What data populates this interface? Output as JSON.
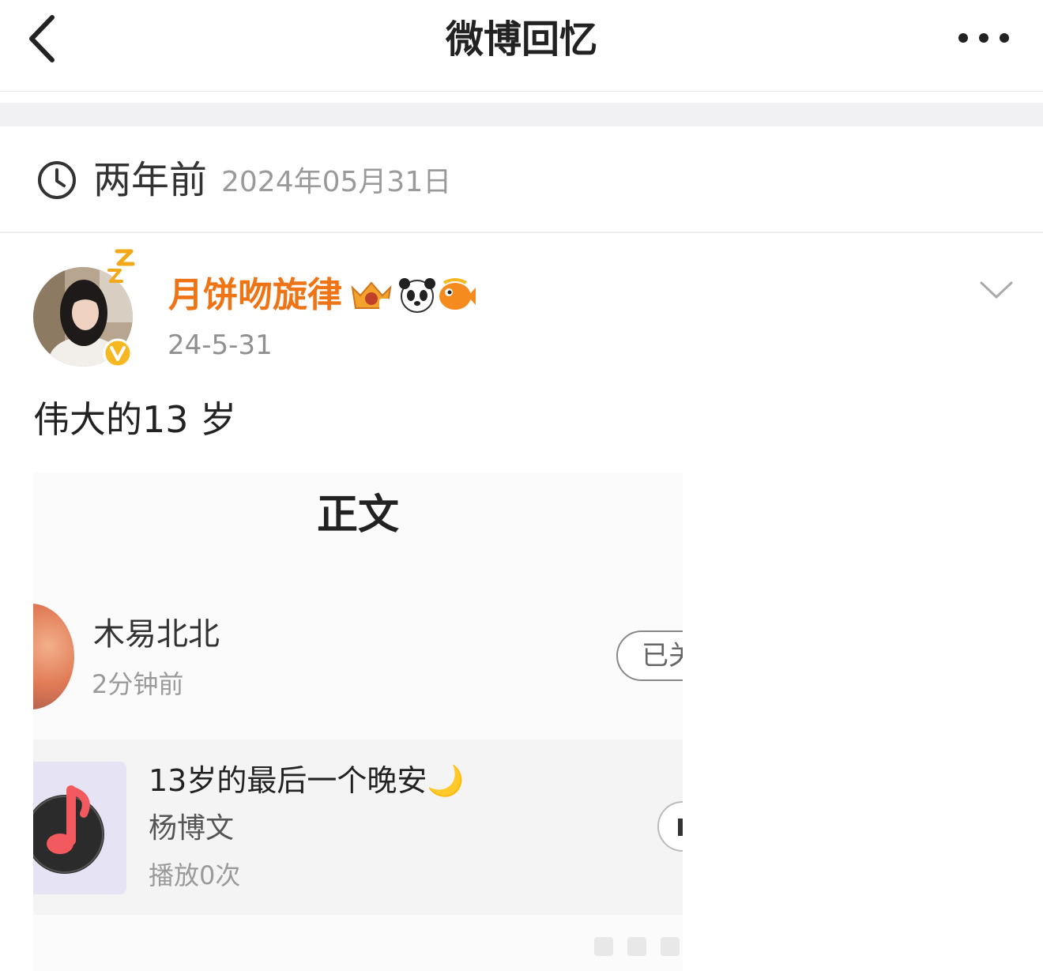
{
  "nav": {
    "title": "微博回忆"
  },
  "memory": {
    "ago": "两年前",
    "date": "2024年05月31日"
  },
  "post": {
    "author": "月饼吻旋律",
    "date": "24-5-31",
    "text": "伟大的13 岁"
  },
  "embedded": {
    "title": "正文",
    "user": "木易北北",
    "time": "2分钟前",
    "follow_label": "已关",
    "song": "13岁的最后一个晚安🌙",
    "artist": "杨博文",
    "plays": "播放0次"
  },
  "colors": {
    "author_name": "#ee7416",
    "verified_badge": "#f6b820",
    "separator_band": "#f1f1f3",
    "music_note": "#f25a5f"
  },
  "icons": [
    "back-arrow-icon",
    "more-dots-icon",
    "clock-icon",
    "verified-v-icon",
    "crown-badge-icon",
    "panda-icon",
    "fish-icon",
    "chevron-down-icon",
    "music-note-icon",
    "play-icon"
  ]
}
